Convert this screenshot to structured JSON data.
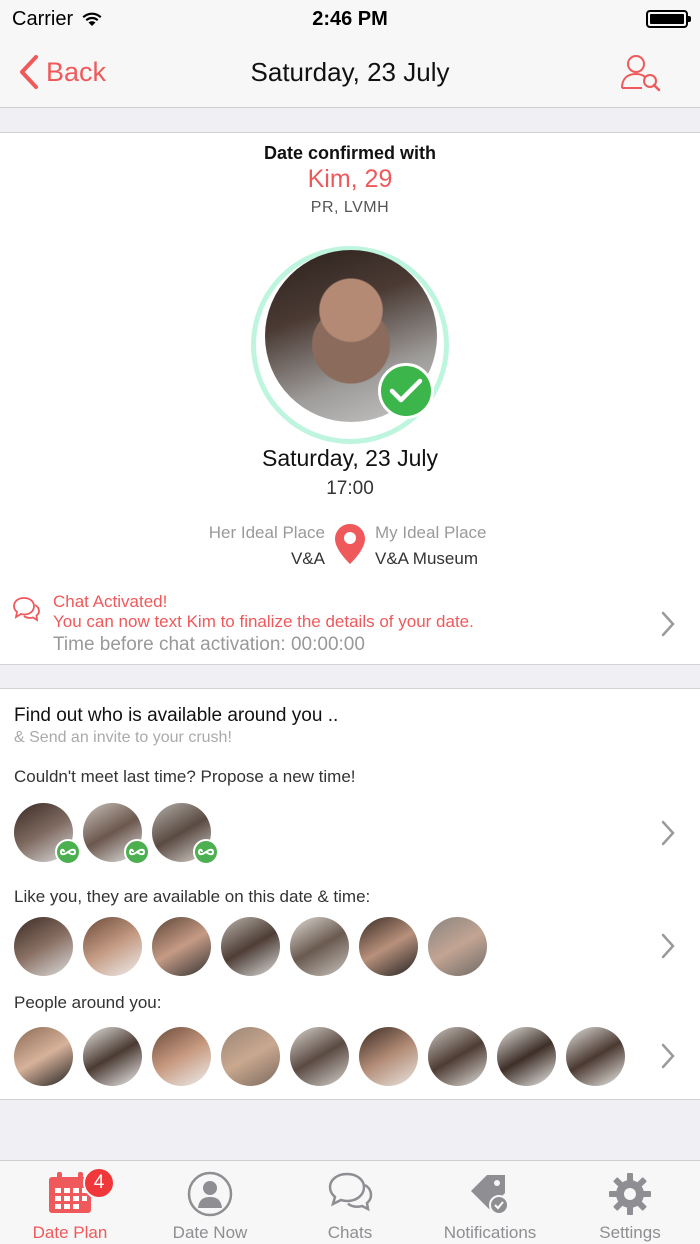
{
  "status": {
    "carrier": "Carrier",
    "time": "2:46 PM"
  },
  "nav": {
    "back_label": "Back",
    "title": "Saturday, 23 July"
  },
  "match": {
    "heading": "Date confirmed with",
    "name": "Kim, 29",
    "job": "PR, LVMH",
    "date": "Saturday, 23 July",
    "time": "17:00",
    "her_place_label": "Her Ideal Place",
    "her_place_value": "V&A",
    "my_place_label": "My Ideal Place",
    "my_place_value": "V&A Museum"
  },
  "chat": {
    "line1": "Chat Activated!",
    "line2": "You can now text Kim to finalize the details of your date.",
    "line3": "Time before chat activation: 00:00:00"
  },
  "discover": {
    "title": "Find out who is available around you ..",
    "subtitle": "& Send an invite to your crush!",
    "propose_label": "Couldn't meet last time? Propose a new time!",
    "available_label": "Like you, they are available on this date & time:",
    "around_label": "People around you:"
  },
  "tabs": [
    {
      "label": "Date Plan",
      "icon": "calendar-icon",
      "badge": "4"
    },
    {
      "label": "Date Now",
      "icon": "person-icon"
    },
    {
      "label": "Chats",
      "icon": "chat-bubbles-icon"
    },
    {
      "label": "Notifications",
      "icon": "tag-check-icon"
    },
    {
      "label": "Settings",
      "icon": "gear-icon"
    }
  ],
  "colors": {
    "accent": "#f0595b",
    "confirm_green": "#3cb54a",
    "ring": "#bdf5df"
  }
}
